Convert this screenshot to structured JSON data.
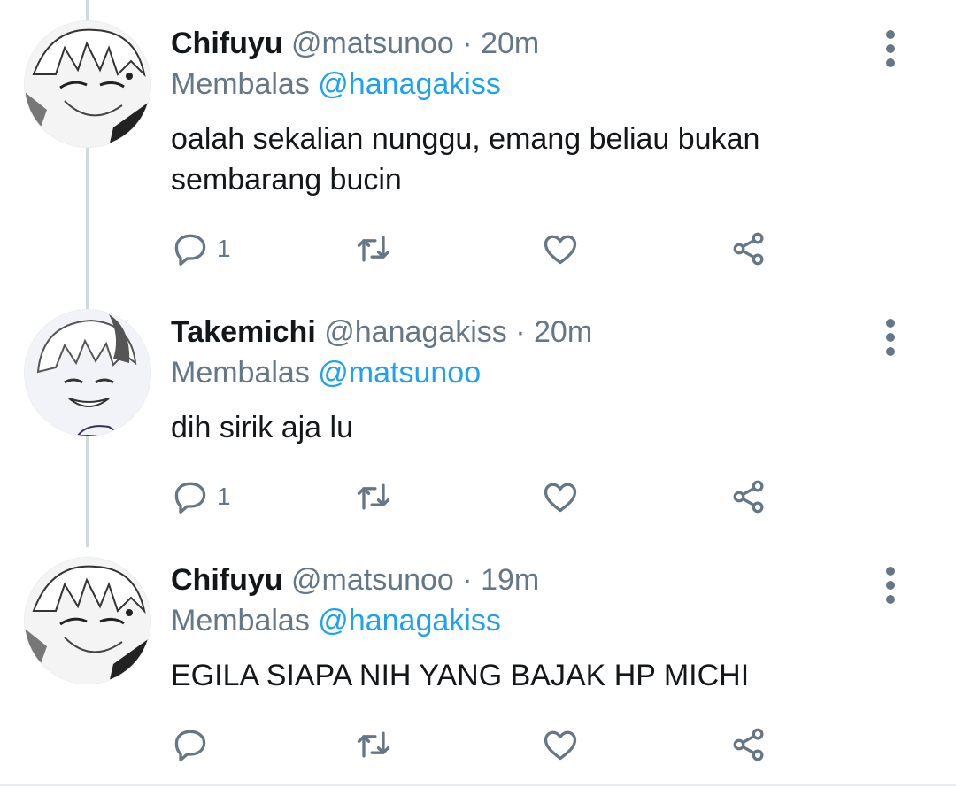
{
  "tweets": [
    {
      "name": "Chifuyu",
      "handle": "@matsunoo",
      "separator": "·",
      "time": "20m",
      "replying_label": "Membalas",
      "replying_to": "@hanagakiss",
      "text_lines": [
        "oalah sekalian nunggu, emang beliau bukan",
        "sembarang bucin"
      ],
      "reply_count": "1",
      "avatar_icon": "avatar-manga-chifuyu"
    },
    {
      "name": "Takemichi",
      "handle": "@hanagakiss",
      "separator": "·",
      "time": "20m",
      "replying_label": "Membalas",
      "replying_to": "@matsunoo",
      "text_lines": [
        "dih sirik aja lu"
      ],
      "reply_count": "1",
      "avatar_icon": "avatar-manga-takemichi"
    },
    {
      "name": "Chifuyu",
      "handle": "@matsunoo",
      "separator": "·",
      "time": "19m",
      "replying_label": "Membalas",
      "replying_to": "@hanagakiss",
      "text_lines": [
        "EGILA SIAPA NIH YANG BAJAK HP MICHI"
      ],
      "reply_count": "",
      "avatar_icon": "avatar-manga-chifuyu"
    }
  ],
  "icons": {
    "reply": "reply-icon",
    "retweet": "retweet-icon",
    "like": "heart-icon",
    "share": "share-icon",
    "more": "more-vertical-icon"
  },
  "colors": {
    "text": "#14171a",
    "secondary": "#657786",
    "mention": "#1da1f2",
    "thread_line": "#cfd9de"
  }
}
